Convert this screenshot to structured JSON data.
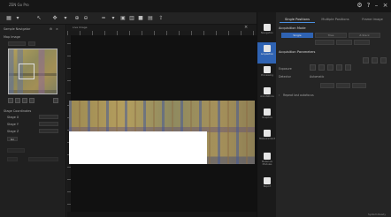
{
  "window": {
    "title": "ZEN Go Pro"
  },
  "left_panel": {
    "header": "Sample Navigator",
    "section_map": "Map Image",
    "section_stage": "Stage Coordinates",
    "stage_fields": [
      {
        "label": "Stage X"
      },
      {
        "label": "Stage Y"
      },
      {
        "label": "Stage Z"
      }
    ],
    "go_button": "Go"
  },
  "canvas": {
    "tab": "Live Image",
    "status": ""
  },
  "right_column": {
    "items": [
      {
        "label": "Navigation",
        "icon": "layers-icon"
      },
      {
        "label": "Acquisition",
        "icon": "camera-icon",
        "active": true
      },
      {
        "label": "Processing",
        "icon": "processing-icon"
      },
      {
        "label": "Annotations",
        "icon": "pen-icon"
      },
      {
        "label": "Graphics",
        "icon": "graphics-icon"
      },
      {
        "label": "Measurement",
        "icon": "measure-icon"
      },
      {
        "label": "Materials Modules",
        "icon": "modules-icon"
      },
      {
        "label": "Report",
        "icon": "report-icon"
      }
    ]
  },
  "props": {
    "tabs": [
      "Single Positions",
      "Multiple Positions",
      "Frame Image"
    ],
    "active_tab": 0,
    "section_acq_mode": "Acquisition Mode",
    "acq_mode_options": [
      "Single",
      "Tiles",
      "Z-Stack"
    ],
    "section_acq_params": "Acquisition Parameters",
    "row_1_label": "Exposure",
    "row_2_label": "Detector",
    "row_2_value": "Automatic",
    "checkbox_label": "Repeat last autofocus",
    "status_text": "System Ready"
  },
  "colors": {
    "accent": "#2f63b3",
    "panel": "#252525",
    "background": "#1e1e1e"
  }
}
